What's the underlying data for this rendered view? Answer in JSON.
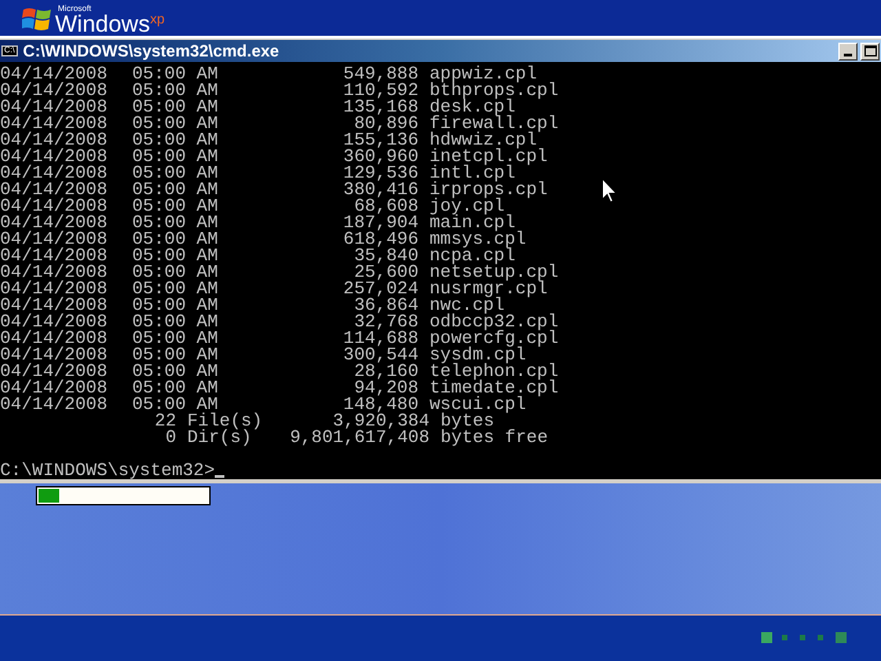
{
  "logo": {
    "company": "Microsoft",
    "product": "Windows",
    "edition": "xp"
  },
  "console_window": {
    "title": "C:\\WINDOWS\\system32\\cmd.exe",
    "icon_text": "C:\\"
  },
  "listing": [
    {
      "date": "04/14/2008",
      "time": "05:00 AM",
      "size": "549,888",
      "name": "appwiz.cpl"
    },
    {
      "date": "04/14/2008",
      "time": "05:00 AM",
      "size": "110,592",
      "name": "bthprops.cpl"
    },
    {
      "date": "04/14/2008",
      "time": "05:00 AM",
      "size": "135,168",
      "name": "desk.cpl"
    },
    {
      "date": "04/14/2008",
      "time": "05:00 AM",
      "size": "80,896",
      "name": "firewall.cpl"
    },
    {
      "date": "04/14/2008",
      "time": "05:00 AM",
      "size": "155,136",
      "name": "hdwwiz.cpl"
    },
    {
      "date": "04/14/2008",
      "time": "05:00 AM",
      "size": "360,960",
      "name": "inetcpl.cpl"
    },
    {
      "date": "04/14/2008",
      "time": "05:00 AM",
      "size": "129,536",
      "name": "intl.cpl"
    },
    {
      "date": "04/14/2008",
      "time": "05:00 AM",
      "size": "380,416",
      "name": "irprops.cpl"
    },
    {
      "date": "04/14/2008",
      "time": "05:00 AM",
      "size": "68,608",
      "name": "joy.cpl"
    },
    {
      "date": "04/14/2008",
      "time": "05:00 AM",
      "size": "187,904",
      "name": "main.cpl"
    },
    {
      "date": "04/14/2008",
      "time": "05:00 AM",
      "size": "618,496",
      "name": "mmsys.cpl"
    },
    {
      "date": "04/14/2008",
      "time": "05:00 AM",
      "size": "35,840",
      "name": "ncpa.cpl"
    },
    {
      "date": "04/14/2008",
      "time": "05:00 AM",
      "size": "25,600",
      "name": "netsetup.cpl"
    },
    {
      "date": "04/14/2008",
      "time": "05:00 AM",
      "size": "257,024",
      "name": "nusrmgr.cpl"
    },
    {
      "date": "04/14/2008",
      "time": "05:00 AM",
      "size": "36,864",
      "name": "nwc.cpl"
    },
    {
      "date": "04/14/2008",
      "time": "05:00 AM",
      "size": "32,768",
      "name": "odbccp32.cpl"
    },
    {
      "date": "04/14/2008",
      "time": "05:00 AM",
      "size": "114,688",
      "name": "powercfg.cpl"
    },
    {
      "date": "04/14/2008",
      "time": "05:00 AM",
      "size": "300,544",
      "name": "sysdm.cpl"
    },
    {
      "date": "04/14/2008",
      "time": "05:00 AM",
      "size": "28,160",
      "name": "telephon.cpl"
    },
    {
      "date": "04/14/2008",
      "time": "05:00 AM",
      "size": "94,208",
      "name": "timedate.cpl"
    },
    {
      "date": "04/14/2008",
      "time": "05:00 AM",
      "size": "148,480",
      "name": "wscui.cpl"
    }
  ],
  "summary": [
    {
      "count": "22",
      "label": "File(s)",
      "amount": "3,920,384",
      "unit": "bytes"
    },
    {
      "count": "0",
      "label": "Dir(s)",
      "amount": "9,801,617,408",
      "unit": "bytes free"
    }
  ],
  "prompt": "C:\\WINDOWS\\system32>",
  "setup_progress": {
    "level": 0.12
  }
}
